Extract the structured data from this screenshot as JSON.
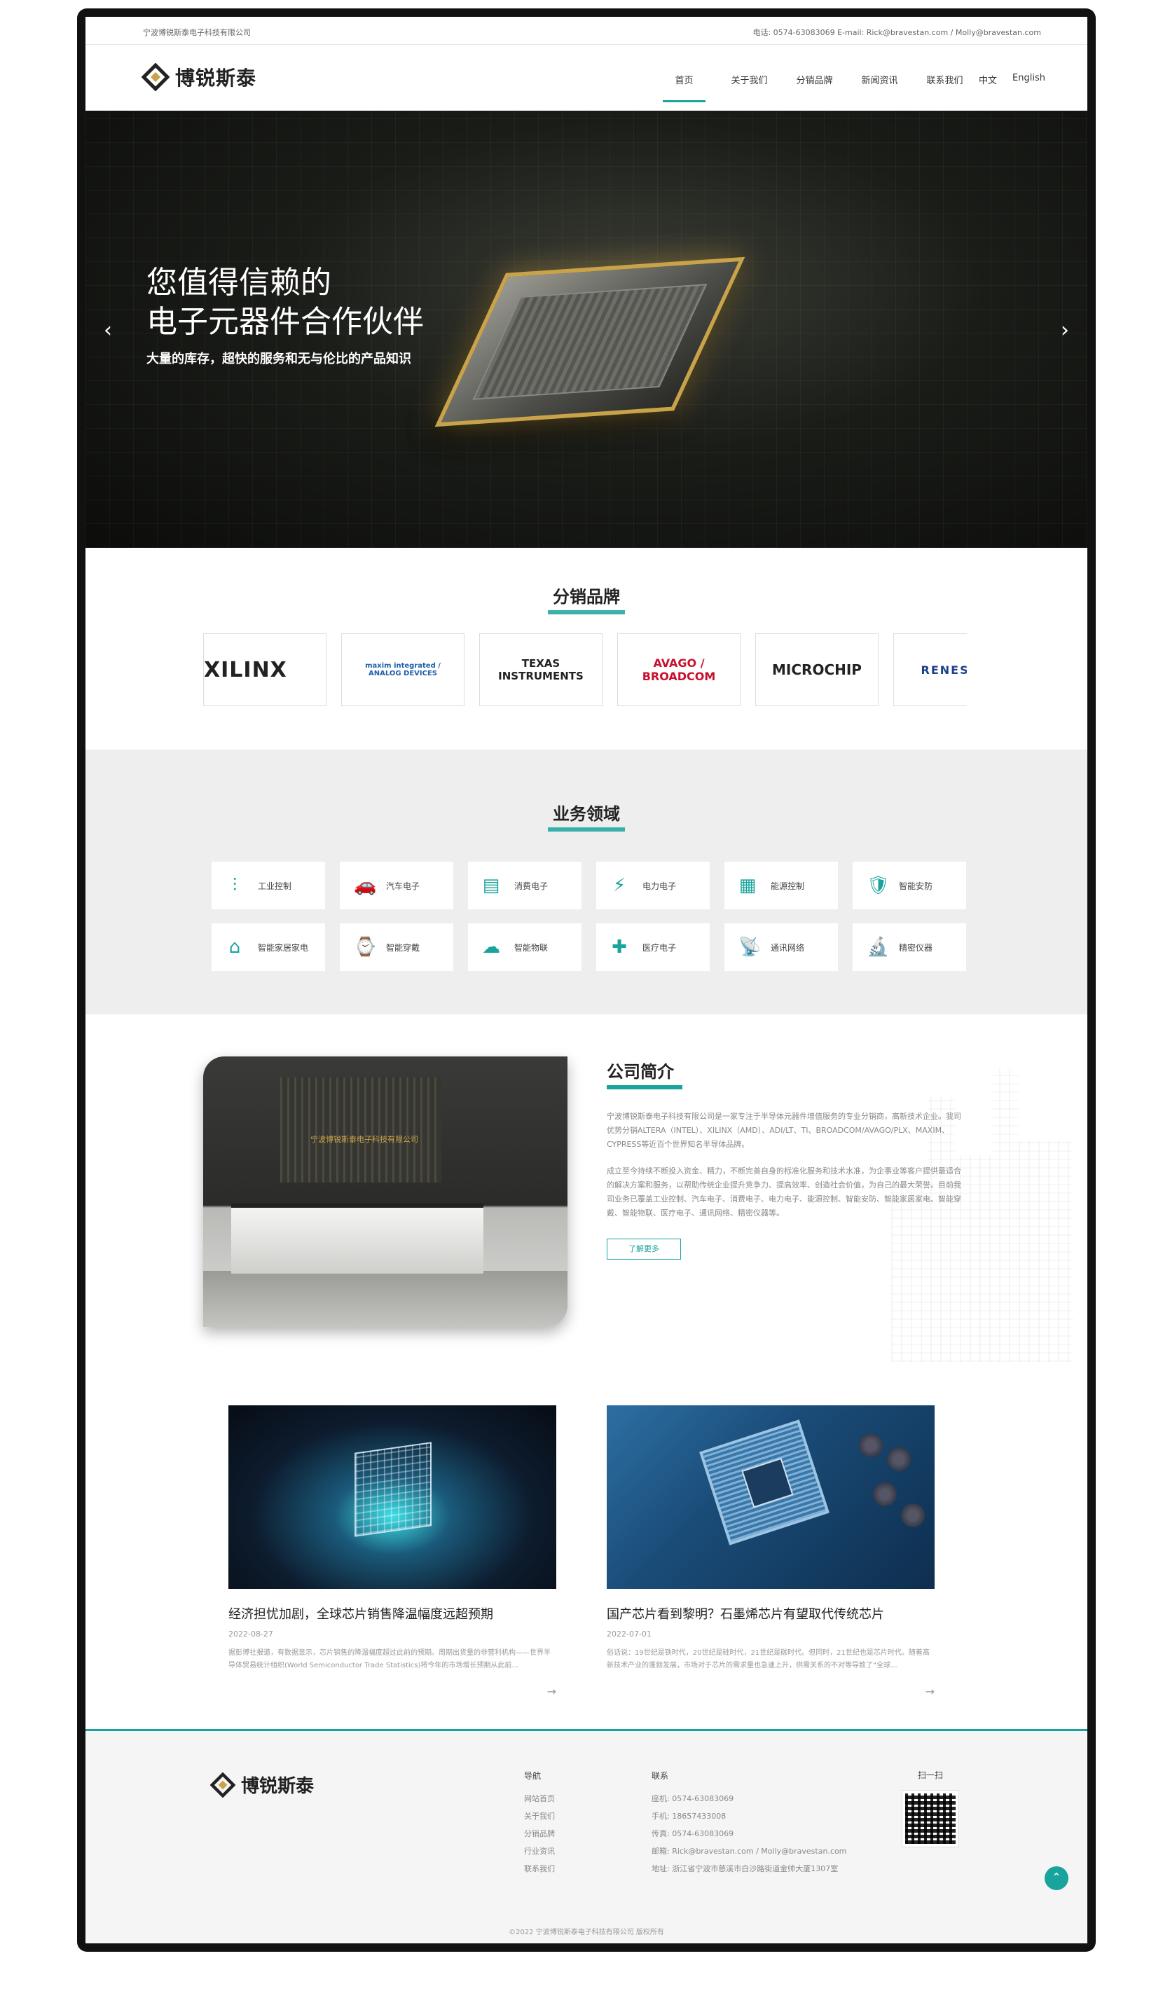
{
  "topbar": {
    "company": "宁波博锐斯泰电子科技有限公司",
    "contact": "电话: 0574-63083069    E-mail: Rick@bravestan.com / Molly@bravestan.com"
  },
  "header": {
    "logo_text": "博锐斯泰",
    "nav": [
      "首页",
      "关于我们",
      "分销品牌",
      "新闻资讯",
      "联系我们"
    ],
    "active": "首页",
    "lang": [
      "中文",
      "English"
    ]
  },
  "hero": {
    "title_line1": "您值得信赖的",
    "title_line2": "电子元器件合作伙伴",
    "subtitle": "大量的库存，超快的服务和无与伦比的产品知识",
    "prev": "‹",
    "next": "›"
  },
  "brands": {
    "title": "分销品牌",
    "items": [
      {
        "name": "XILINX",
        "color": "#c8102e"
      },
      {
        "name": "maxim integrated / ANALOG DEVICES",
        "color": "#1d5fa9"
      },
      {
        "name": "TEXAS INSTRUMENTS",
        "color": "#c8102e"
      },
      {
        "name": "AVAGO / BROADCOM",
        "color": "#c8102e"
      },
      {
        "name": "MICROCHIP",
        "color": "#c8102e"
      },
      {
        "name": "RENESAS",
        "color": "#1d3f8e"
      }
    ]
  },
  "business": {
    "title": "业务领域",
    "items": [
      {
        "label": "工业控制",
        "icon": "sliders-icon",
        "glyph": "⫶"
      },
      {
        "label": "汽车电子",
        "icon": "car-icon",
        "glyph": "🚗"
      },
      {
        "label": "消费电子",
        "icon": "register-icon",
        "glyph": "▤"
      },
      {
        "label": "电力电子",
        "icon": "power-tower-icon",
        "glyph": "⚡"
      },
      {
        "label": "能源控制",
        "icon": "solar-panel-icon",
        "glyph": "▦"
      },
      {
        "label": "智能安防",
        "icon": "security-icon",
        "glyph": "🛡"
      },
      {
        "label": "智能家居家电",
        "icon": "smart-home-icon",
        "glyph": "⌂"
      },
      {
        "label": "智能穿戴",
        "icon": "watch-icon",
        "glyph": "⌚"
      },
      {
        "label": "智能物联",
        "icon": "iot-icon",
        "glyph": "☁"
      },
      {
        "label": "医疗电子",
        "icon": "hospital-icon",
        "glyph": "✚"
      },
      {
        "label": "通讯网络",
        "icon": "antenna-icon",
        "glyph": "📡"
      },
      {
        "label": "精密仪器",
        "icon": "microscope-icon",
        "glyph": "🔬"
      }
    ]
  },
  "about": {
    "title": "公司简介",
    "sign_text": "宁波博锐斯泰电子科技有限公司",
    "p1": "宁波博锐斯泰电子科技有限公司是一家专注于半导体元器件增值服务的专业分销商，高新技术企业。我司优势分销ALTERA（INTEL）、XILINX（AMD）、ADI/LT、TI、BROADCOM/AVAGO/PLX、MAXIM、CYPRESS等近百个世界知名半导体品牌。",
    "p2": "成立至今持续不断投入资金、精力，不断完善自身的标准化服务和技术水准，为企事业等客户提供最适合的解决方案和服务，以帮助传统企业提升竞争力、提高效率、创造社会价值，为自己的最大荣誉。目前我司业务已覆盖工业控制、汽车电子、消费电子、电力电子、能源控制、智能安防、智能家居家电、智能穿戴、智能物联、医疗电子、通讯网络、精密仪器等。",
    "more": "了解更多"
  },
  "news": [
    {
      "title": "经济担忧加剧，全球芯片销售降温幅度远超预期",
      "date": "2022-08-27",
      "summary": "据彭博社报道，有数据显示，芯片销售的降温幅度超过此前的预期。周期出货量的非营利机构——世界半导体贸易统计组织(World Semiconductor Trade Statistics)将今年的市场增长预期从此前...",
      "arrow": "→"
    },
    {
      "title": "国产芯片看到黎明？石墨烯芯片有望取代传统芯片",
      "date": "2022-07-01",
      "summary": "俗话说：19世纪是铁时代，20世纪是硅时代，21世纪是碳时代。但同时，21世纪也是芯片时代。随着高新技术产业的蓬勃发展，市场对于芯片的需求量也急速上升，供需关系的不对等导致了“全球...",
      "arrow": "→"
    }
  ],
  "footer": {
    "logo_text": "博锐斯泰",
    "nav_title": "导航",
    "nav_links": [
      "网站首页",
      "关于我们",
      "分销品牌",
      "行业资讯",
      "联系我们"
    ],
    "contact_title": "联系",
    "contact": [
      "座机:  0574-63083069",
      "手机:  18657433008",
      "传真:  0574-63083069",
      "邮箱:  Rick@bravestan.com / Molly@bravestan.com",
      "地址:  浙江省宁波市慈溪市白沙路街道金帅大厦1307室"
    ],
    "qr_title": "扫一扫",
    "copyright": "©2022 宁波博锐斯泰电子科技有限公司 版权所有",
    "to_top": "⌃"
  },
  "colors": {
    "accent": "#18a39d",
    "logo_gold": "#c9a34a"
  }
}
